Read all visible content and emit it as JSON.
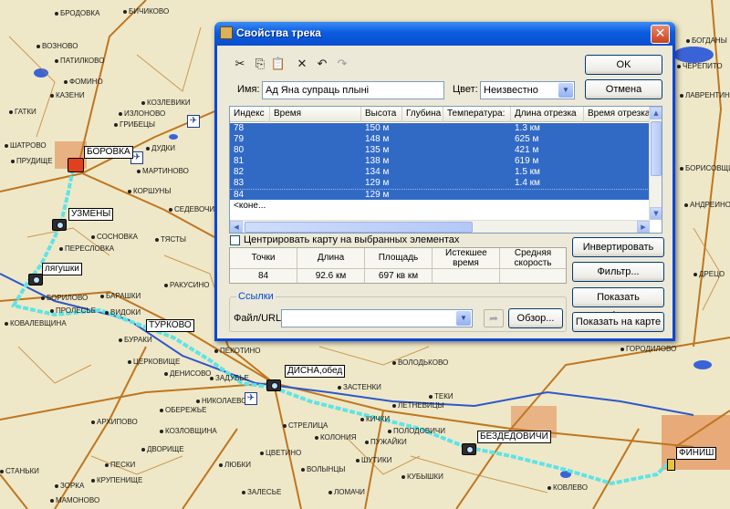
{
  "map": {
    "towns": [
      {
        "name": "ВОЗНОВО"
      },
      {
        "name": "БИЧИКОВО"
      },
      {
        "name": "БРОДОВКА"
      },
      {
        "name": "ПАТИЛКОВО"
      },
      {
        "name": "ИЗЛОНОВО"
      },
      {
        "name": "ФОМИНО"
      },
      {
        "name": "КАЗЕНИ"
      },
      {
        "name": "ГАТКИ"
      },
      {
        "name": "ГРИБЕЦЫ"
      },
      {
        "name": "КОЗЛЕВИКИ"
      },
      {
        "name": "ШАТРОВО"
      },
      {
        "name": "МАРТИНОВО"
      },
      {
        "name": "ПРУДИЩЕ"
      },
      {
        "name": "КОРШУНЫ"
      },
      {
        "name": "ДУДКИ"
      },
      {
        "name": "СЕДЕВОЧИ"
      },
      {
        "name": "СОСНОВКА"
      },
      {
        "name": "ПЕРЕСЛОВКА"
      },
      {
        "name": "ТЯСТЫ"
      },
      {
        "name": "БОРИЛОВО"
      },
      {
        "name": "ПРОЛЕСЬЕ"
      },
      {
        "name": "ВИДОКИ"
      },
      {
        "name": "БАРАШКИ"
      },
      {
        "name": "РАКУСИНО"
      },
      {
        "name": "БУРАКИ"
      },
      {
        "name": "ЦЕРКОВИЩЕ"
      },
      {
        "name": "ДЕНИСОВО"
      },
      {
        "name": "ПЕКОТИНО"
      },
      {
        "name": "ЗАДУБЬЕ"
      },
      {
        "name": "НИКОЛАЕВО"
      },
      {
        "name": "ОБЕРЕЖЬЕ"
      },
      {
        "name": "КОВАЛЕВЩИНА"
      },
      {
        "name": "ВОЛОДЬКОВО"
      },
      {
        "name": "ЛЕТНЕВИЦЫ"
      },
      {
        "name": "ЗАСТЕНКИ"
      },
      {
        "name": "КИЧКИ"
      },
      {
        "name": "ПОЛОДОВИЧИ"
      },
      {
        "name": "КОЗЛОВЩИНА"
      },
      {
        "name": "АРХИПОВО"
      },
      {
        "name": "СТРЕЛИЦА"
      },
      {
        "name": "ЦВЕТИНО"
      },
      {
        "name": "ВОЛЫНЦЫ"
      },
      {
        "name": "ЛЮБКИ"
      },
      {
        "name": "КОЛОНИЯ"
      },
      {
        "name": "ШУТИКИ"
      },
      {
        "name": "ТЕКИ"
      },
      {
        "name": "ДВОРИЩЕ"
      },
      {
        "name": "ПУЖАЙКИ"
      },
      {
        "name": "КУБЫШКИ"
      },
      {
        "name": "ПЕСКИ"
      },
      {
        "name": "ЗОРКА"
      },
      {
        "name": "КРУПЕНИЩЕ"
      },
      {
        "name": "МАМОНОВО"
      },
      {
        "name": "СТАНЬКИ"
      },
      {
        "name": "ЗАЛЕСЬЕ"
      },
      {
        "name": "ЛОМАЧИ"
      },
      {
        "name": "ГОРОДИЛОВО"
      },
      {
        "name": "БОГДАНЫ"
      },
      {
        "name": "ЧЕРЕПИТО"
      },
      {
        "name": "ЛАВРЕНТИНО"
      },
      {
        "name": "БОРИСОВЩИНА"
      },
      {
        "name": "АНДРЕИНО"
      },
      {
        "name": "ДРЕЦО"
      },
      {
        "name": "КОВЛЕВО"
      }
    ],
    "waypoints": [
      {
        "label": "БОРОВКА"
      },
      {
        "label": "УЗМЕНЫ"
      },
      {
        "label": "лягушки"
      },
      {
        "label": "ТУРКОВО"
      },
      {
        "label": "ДИСНА,обед"
      },
      {
        "label": "БЕЗДЕДОВИЧИ"
      },
      {
        "label": "ФИНИШ"
      }
    ],
    "colors": {
      "background": "#eee8c8",
      "track": "#5fe3e6",
      "road": "#c0751f",
      "river": "#2f57c9",
      "water": "#3a63d8",
      "urban": "#e6a36f"
    }
  },
  "dialog": {
    "title": "Свойства трека",
    "close_label": "✕",
    "toolbar": [
      {
        "name": "cut-icon",
        "glyph": "✂"
      },
      {
        "name": "copy-icon",
        "glyph": "⎘"
      },
      {
        "name": "paste-icon",
        "glyph": "📋"
      },
      {
        "name": "delete-icon",
        "glyph": "✕"
      },
      {
        "name": "undo-icon",
        "glyph": "↶"
      },
      {
        "name": "redo-icon",
        "glyph": "↷"
      }
    ],
    "name_label": "Имя:",
    "name_value": "Ад Яна супраць плыні",
    "color_label": "Цвет:",
    "color_value": "Неизвестно",
    "ok_label": "OK",
    "cancel_label": "Отмена",
    "columns": [
      "Индекс",
      "Время",
      "Высота",
      "Глубина",
      "Температура:",
      "Длина отрезка",
      "Время отрезка"
    ],
    "rows": [
      {
        "index": "78",
        "time": "",
        "altitude": "150 м",
        "depth": "",
        "temp": "",
        "seg_len": "1.3 км",
        "seg_time": ""
      },
      {
        "index": "79",
        "time": "",
        "altitude": "148 м",
        "depth": "",
        "temp": "",
        "seg_len": "625 м",
        "seg_time": ""
      },
      {
        "index": "80",
        "time": "",
        "altitude": "135 м",
        "depth": "",
        "temp": "",
        "seg_len": "421 м",
        "seg_time": ""
      },
      {
        "index": "81",
        "time": "",
        "altitude": "138 м",
        "depth": "",
        "temp": "",
        "seg_len": "619 м",
        "seg_time": ""
      },
      {
        "index": "82",
        "time": "",
        "altitude": "134 м",
        "depth": "",
        "temp": "",
        "seg_len": "1.5 км",
        "seg_time": ""
      },
      {
        "index": "83",
        "time": "",
        "altitude": "129 м",
        "depth": "",
        "temp": "",
        "seg_len": "1.4 км",
        "seg_time": ""
      },
      {
        "index": "84",
        "time": "",
        "altitude": "129 м",
        "depth": "",
        "temp": "",
        "seg_len": "",
        "seg_time": ""
      }
    ],
    "end_row": "<коне...",
    "center_map_label": "Центрировать карту на выбранных элементах",
    "stats_headers": [
      "Точки",
      "Длина",
      "Площадь",
      "Истекшее время",
      "Средняя скорость"
    ],
    "stats_values": [
      "84",
      "92.6 км",
      "697 кв км",
      "",
      ""
    ],
    "invert_label": "Инвертировать",
    "filter_label": "Фильтр...",
    "profile_label": "Показать профиль...",
    "show_map_label": "Показать на карте",
    "links_legend": "Ссылки",
    "file_url_label": "Файл/URL:",
    "file_url_value": "",
    "browse_label": "Обзор..."
  }
}
